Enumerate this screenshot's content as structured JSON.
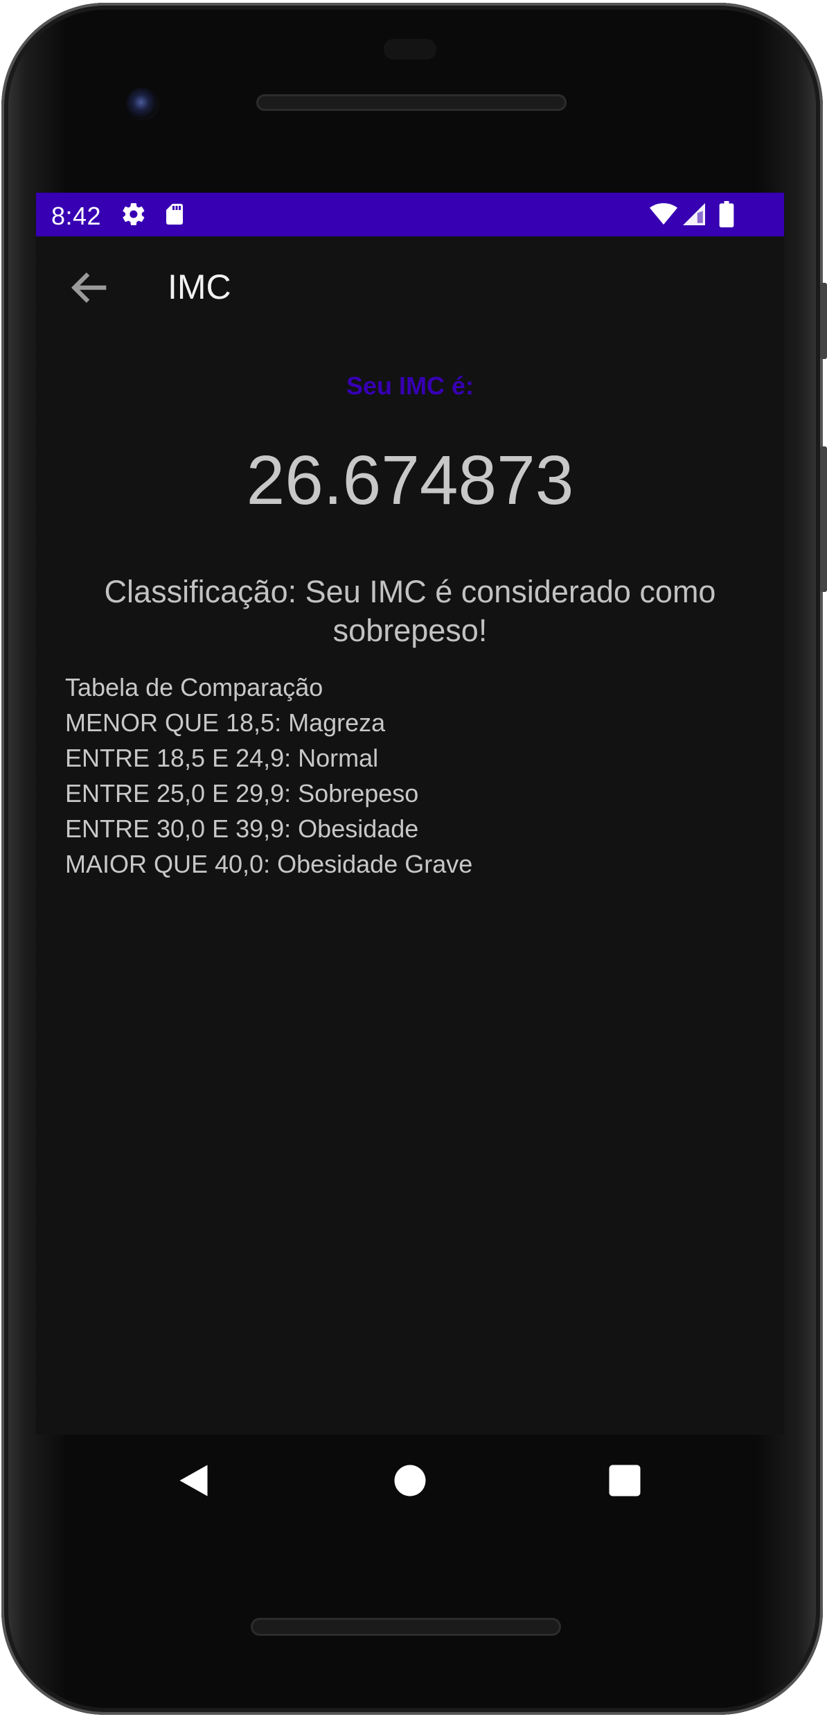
{
  "status_bar": {
    "time": "8:42",
    "background": "#3700b3",
    "icons_left": [
      "gear-icon",
      "sd-card-icon"
    ],
    "icons_right": [
      "wifi-icon",
      "signal-icon",
      "battery-icon"
    ]
  },
  "app_bar": {
    "title": "IMC",
    "back_icon": "arrow-back-icon"
  },
  "main": {
    "label": "Seu IMC é:",
    "value": "26.674873",
    "classification": "Classificação: Seu IMC é considerado como sobrepeso!",
    "table": {
      "title": "Tabela de Comparação",
      "rows": [
        "MENOR QUE 18,5: Magreza",
        "ENTRE 18,5 E 24,9: Normal",
        "ENTRE 25,0 E 29,9: Sobrepeso",
        "ENTRE 30,0 E 39,9: Obesidade",
        "MAIOR QUE 40,0: Obesidade Grave"
      ]
    }
  },
  "nav_bar": {
    "buttons": [
      "back-triangle-icon",
      "home-circle-icon",
      "recents-square-icon"
    ]
  },
  "colors": {
    "accent": "#3700b3",
    "screen_background": "#121212",
    "text_primary": "#c8c8c8"
  }
}
